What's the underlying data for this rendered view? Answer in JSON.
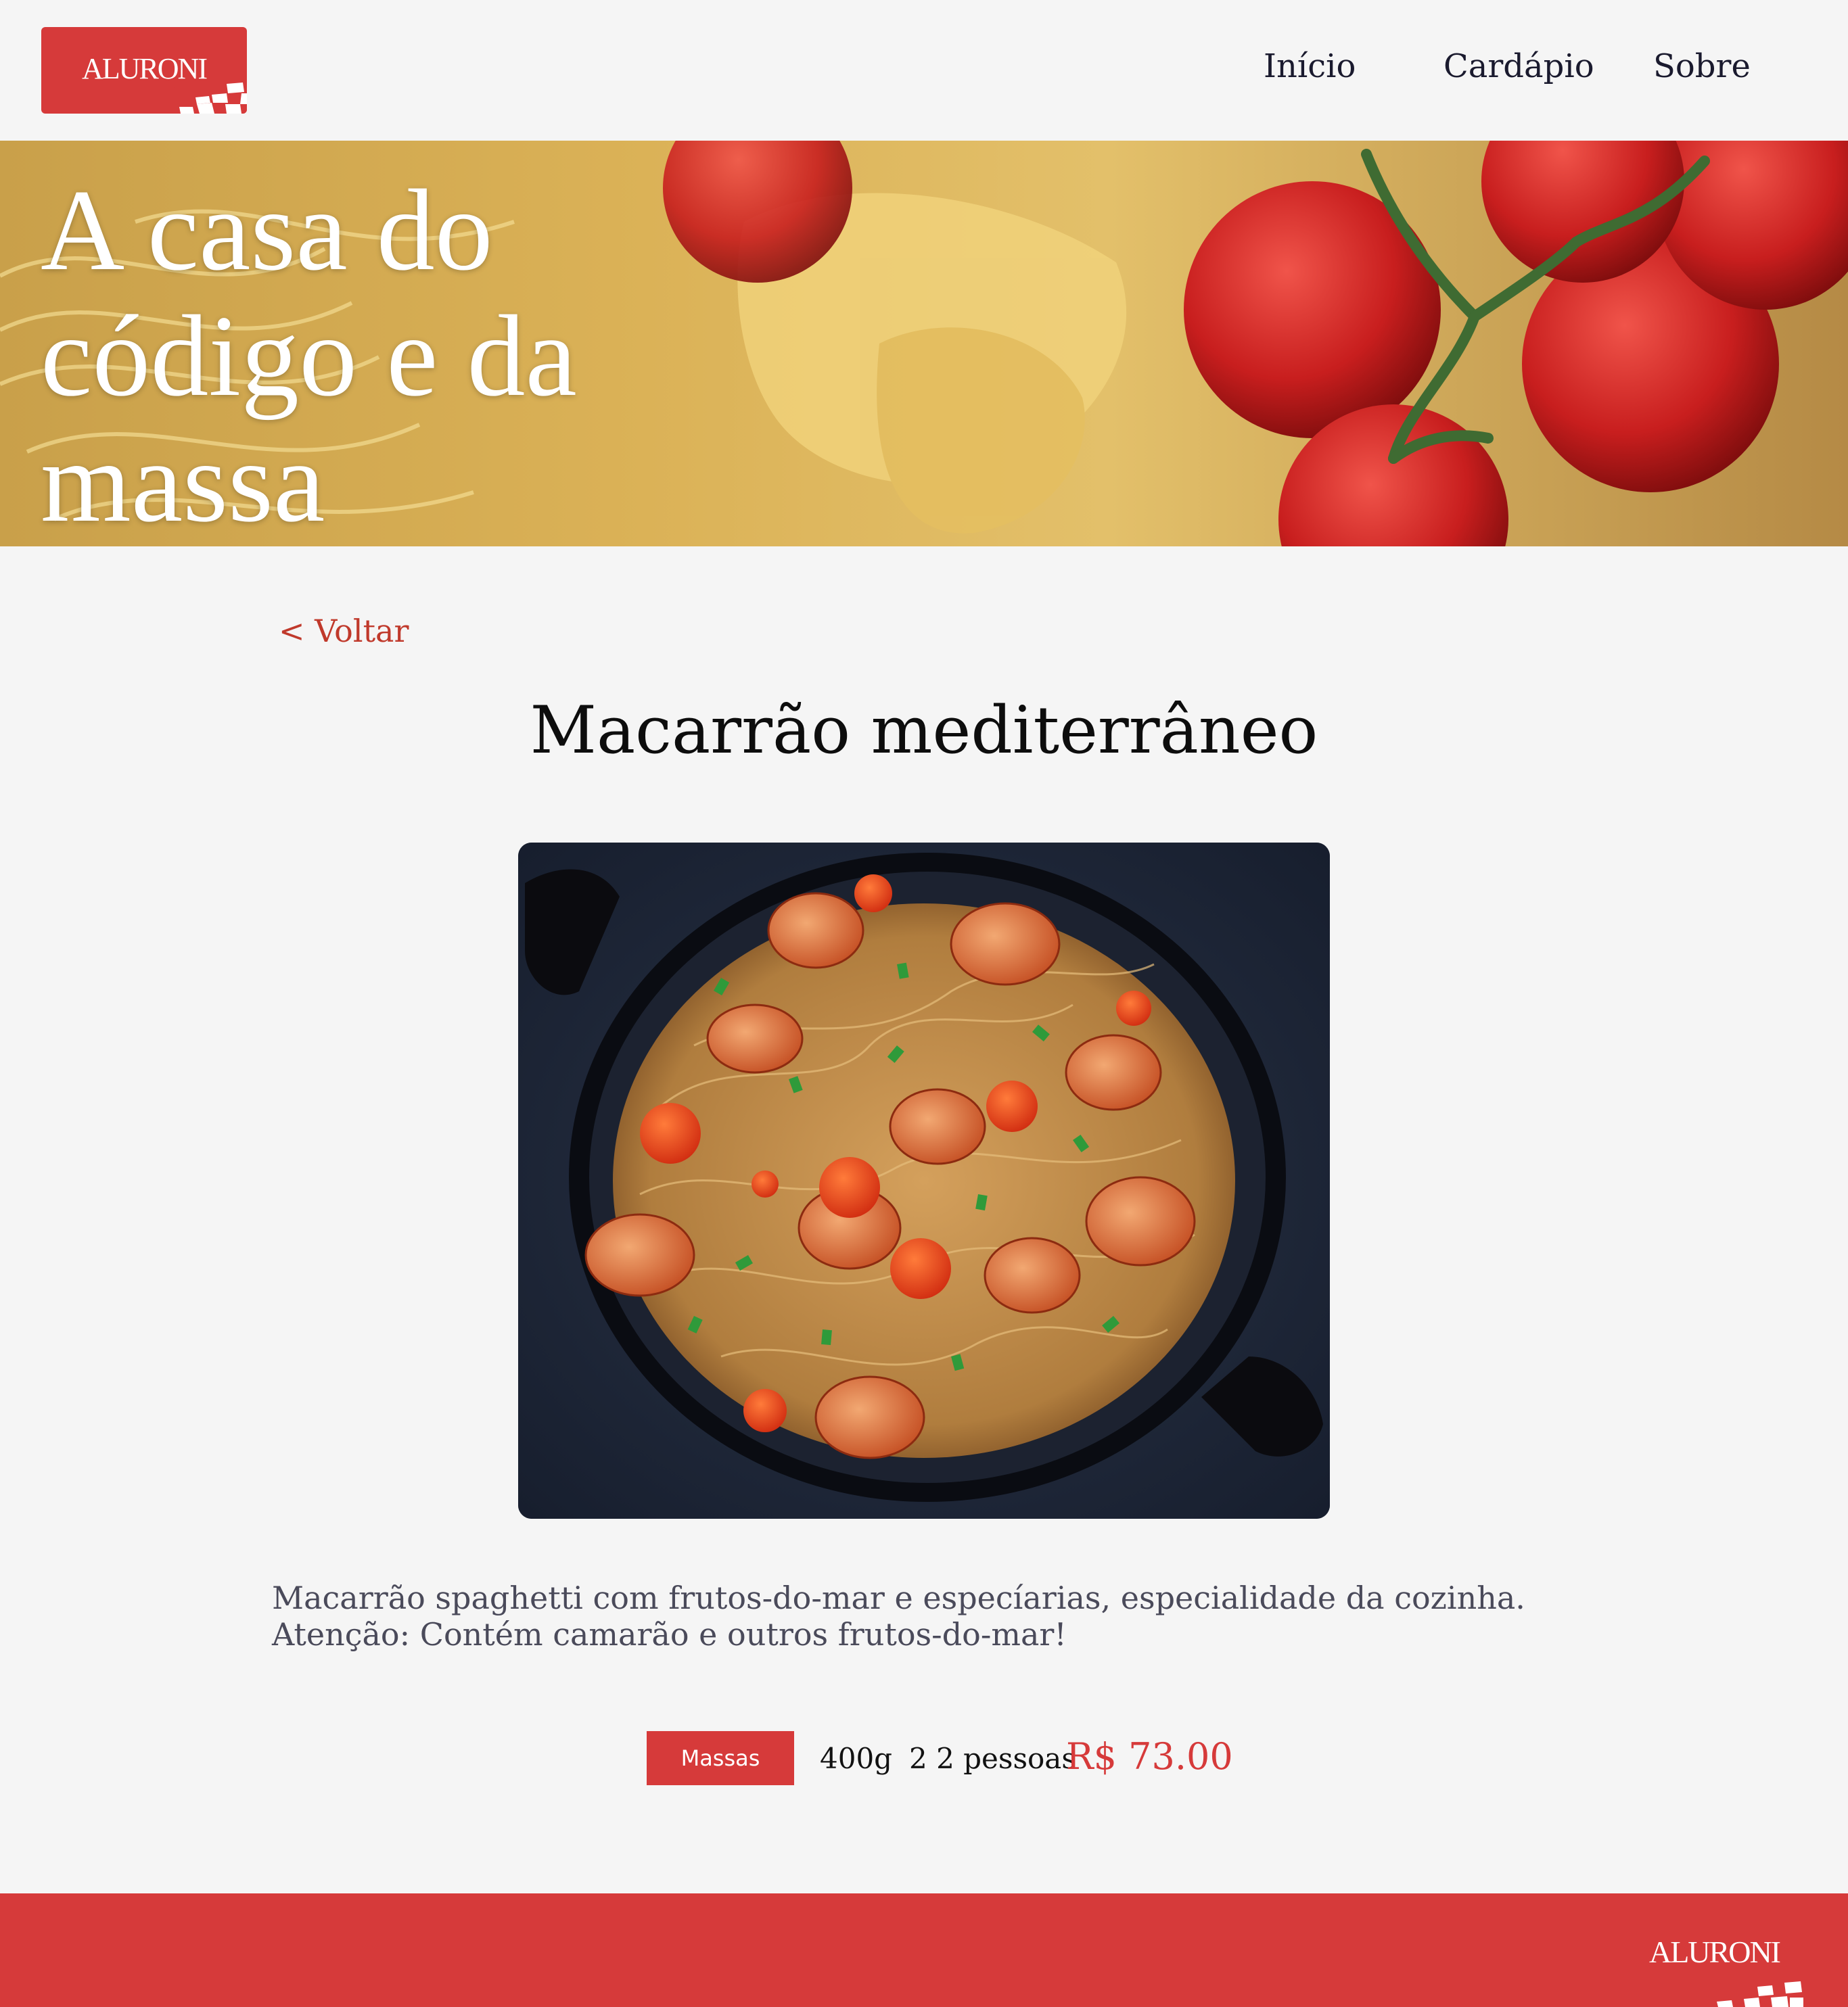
{
  "header": {
    "logo_text": "ALURONI",
    "nav": [
      {
        "label": "Início"
      },
      {
        "label": "Cardápio"
      },
      {
        "label": "Sobre"
      }
    ]
  },
  "hero": {
    "title": "A casa do código e da massa"
  },
  "content": {
    "back_label": "< Voltar",
    "dish_title": "Macarrão mediterrâneo",
    "description": "Macarrão spaghetti com frutos-do-mar e especíarias, especialidade da cozinha. Atenção: Contém camarão e outros frutos-do-mar!",
    "category": "Massas",
    "size": "400g",
    "serving": "2 2 pessoas",
    "price": "R$ 73.00"
  },
  "footer": {
    "logo_text": "ALURONI"
  },
  "colors": {
    "brand_red": "#d63a3a",
    "background": "#f5f5f5",
    "text_dark": "#1a1a2e"
  }
}
